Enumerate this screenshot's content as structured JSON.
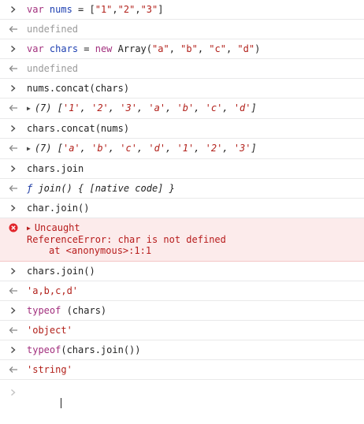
{
  "entries": [
    {
      "kind": "input",
      "segments": [
        {
          "t": "var",
          "c": "kw"
        },
        {
          "t": " "
        },
        {
          "t": "nums",
          "c": "var"
        },
        {
          "t": " = ["
        },
        {
          "t": "\"1\"",
          "c": "str"
        },
        {
          "t": ","
        },
        {
          "t": "\"2\"",
          "c": "str"
        },
        {
          "t": ","
        },
        {
          "t": "\"3\"",
          "c": "str"
        },
        {
          "t": "]"
        }
      ]
    },
    {
      "kind": "output",
      "segments": [
        {
          "t": "undefined",
          "c": "muted"
        }
      ]
    },
    {
      "kind": "input",
      "segments": [
        {
          "t": "var",
          "c": "kw"
        },
        {
          "t": " "
        },
        {
          "t": "chars",
          "c": "var"
        },
        {
          "t": " = "
        },
        {
          "t": "new",
          "c": "kw"
        },
        {
          "t": " Array("
        },
        {
          "t": "\"a\"",
          "c": "str"
        },
        {
          "t": ", "
        },
        {
          "t": "\"b\"",
          "c": "str"
        },
        {
          "t": ", "
        },
        {
          "t": "\"c\"",
          "c": "str"
        },
        {
          "t": ", "
        },
        {
          "t": "\"d\"",
          "c": "str"
        },
        {
          "t": ")"
        }
      ]
    },
    {
      "kind": "output",
      "segments": [
        {
          "t": "undefined",
          "c": "muted"
        }
      ]
    },
    {
      "kind": "input",
      "segments": [
        {
          "t": "nums.concat(chars)"
        }
      ]
    },
    {
      "kind": "output-array",
      "segments": [
        {
          "t": "(7) ",
          "c": "ital dark"
        },
        {
          "t": "[",
          "c": "ital dark"
        },
        {
          "t": "'1'",
          "c": "str ital"
        },
        {
          "t": ", ",
          "c": "ital dark"
        },
        {
          "t": "'2'",
          "c": "str ital"
        },
        {
          "t": ", ",
          "c": "ital dark"
        },
        {
          "t": "'3'",
          "c": "str ital"
        },
        {
          "t": ", ",
          "c": "ital dark"
        },
        {
          "t": "'a'",
          "c": "str ital"
        },
        {
          "t": ", ",
          "c": "ital dark"
        },
        {
          "t": "'b'",
          "c": "str ital"
        },
        {
          "t": ", ",
          "c": "ital dark"
        },
        {
          "t": "'c'",
          "c": "str ital"
        },
        {
          "t": ", ",
          "c": "ital dark"
        },
        {
          "t": "'d'",
          "c": "str ital"
        },
        {
          "t": "]",
          "c": "ital dark"
        }
      ]
    },
    {
      "kind": "input",
      "segments": [
        {
          "t": "chars.concat(nums)"
        }
      ]
    },
    {
      "kind": "output-array",
      "segments": [
        {
          "t": "(7) ",
          "c": "ital dark"
        },
        {
          "t": "[",
          "c": "ital dark"
        },
        {
          "t": "'a'",
          "c": "str ital"
        },
        {
          "t": ", ",
          "c": "ital dark"
        },
        {
          "t": "'b'",
          "c": "str ital"
        },
        {
          "t": ", ",
          "c": "ital dark"
        },
        {
          "t": "'c'",
          "c": "str ital"
        },
        {
          "t": ", ",
          "c": "ital dark"
        },
        {
          "t": "'d'",
          "c": "str ital"
        },
        {
          "t": ", ",
          "c": "ital dark"
        },
        {
          "t": "'1'",
          "c": "str ital"
        },
        {
          "t": ", ",
          "c": "ital dark"
        },
        {
          "t": "'2'",
          "c": "str ital"
        },
        {
          "t": ", ",
          "c": "ital dark"
        },
        {
          "t": "'3'",
          "c": "str ital"
        },
        {
          "t": "]",
          "c": "ital dark"
        }
      ]
    },
    {
      "kind": "input",
      "segments": [
        {
          "t": "chars.join"
        }
      ]
    },
    {
      "kind": "output",
      "segments": [
        {
          "t": "ƒ",
          "c": "fn"
        },
        {
          "t": " join() { [native code] }",
          "c": "ital dark"
        }
      ]
    },
    {
      "kind": "input",
      "segments": [
        {
          "t": "char.join()"
        }
      ]
    },
    {
      "kind": "error",
      "lines": [
        "Uncaught",
        "ReferenceError: char is not defined",
        "at <anonymous>:1:1"
      ]
    },
    {
      "kind": "input",
      "segments": [
        {
          "t": "chars.join()"
        }
      ]
    },
    {
      "kind": "output",
      "segments": [
        {
          "t": "'a,b,c,d'",
          "c": "str"
        }
      ]
    },
    {
      "kind": "input",
      "segments": [
        {
          "t": "typeof",
          "c": "kw"
        },
        {
          "t": " (chars)"
        }
      ]
    },
    {
      "kind": "output",
      "segments": [
        {
          "t": "'object'",
          "c": "str"
        }
      ]
    },
    {
      "kind": "input",
      "segments": [
        {
          "t": "typeof",
          "c": "kw"
        },
        {
          "t": "(chars.join())"
        }
      ]
    },
    {
      "kind": "output",
      "segments": [
        {
          "t": "'string'",
          "c": "str"
        }
      ]
    }
  ],
  "prompt": {
    "value": ""
  },
  "icons": {
    "input": "chevron-right-icon",
    "output": "return-arrow-icon",
    "error": "error-x-icon",
    "expand": "expand-triangle-icon"
  },
  "colors": {
    "keyword": "#a2307e",
    "string": "#b2211b",
    "variable": "#1d3fb1",
    "error_bg": "#fcebeb",
    "error_icon": "#e1252b"
  }
}
